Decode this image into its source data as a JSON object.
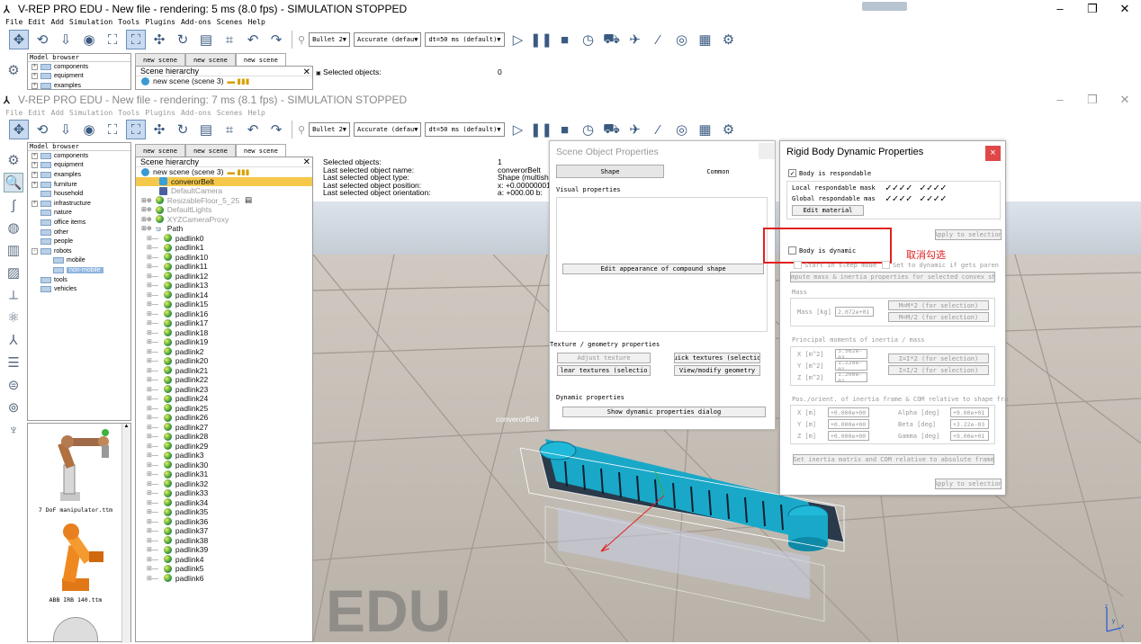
{
  "back_window": {
    "title": "V-REP PRO EDU - New file - rendering: 5 ms (8.0 fps) - SIMULATION STOPPED",
    "menu": [
      "File",
      "Edit",
      "Add",
      "Simulation",
      "Tools",
      "Plugins",
      "Add-ons",
      "Scenes",
      "Help"
    ],
    "model_browser_label": "Model browser",
    "model_items": [
      "components",
      "equipment",
      "examples"
    ],
    "tabs": [
      "new scene",
      "new scene",
      "new scene"
    ],
    "scene_hierarchy_label": "Scene hierarchy",
    "scene_root": "new scene (scene 3)",
    "selected_label": "Selected objects:",
    "selected_value": "0"
  },
  "front_window": {
    "title": "V-REP PRO EDU - New file - rendering: 7 ms (8.1 fps) - SIMULATION STOPPED",
    "menu": [
      "File",
      "Edit",
      "Add",
      "Simulation",
      "Tools",
      "Plugins",
      "Add-ons",
      "Scenes",
      "Help"
    ]
  },
  "toolbar": {
    "engine": "Bullet 2",
    "accuracy": "Accurate (defau",
    "dt": "dt=50 ms (default)"
  },
  "model_browser": {
    "label": "Model browser",
    "items": [
      {
        "label": "components",
        "expand": "+",
        "indent": 0
      },
      {
        "label": "equipment",
        "expand": "+",
        "indent": 0
      },
      {
        "label": "examples",
        "expand": "+",
        "indent": 0
      },
      {
        "label": "furniture",
        "expand": "+",
        "indent": 0
      },
      {
        "label": "household",
        "expand": "",
        "indent": 0
      },
      {
        "label": "infrastructure",
        "expand": "+",
        "indent": 0
      },
      {
        "label": "nature",
        "expand": "",
        "indent": 0
      },
      {
        "label": "office items",
        "expand": "",
        "indent": 0
      },
      {
        "label": "other",
        "expand": "",
        "indent": 0
      },
      {
        "label": "people",
        "expand": "",
        "indent": 0
      },
      {
        "label": "robots",
        "expand": "-",
        "indent": 0
      },
      {
        "label": "mobile",
        "expand": "",
        "indent": 1
      },
      {
        "label": "non-mobile",
        "expand": "",
        "indent": 1,
        "selected": true
      },
      {
        "label": "tools",
        "expand": "",
        "indent": 0
      },
      {
        "label": "vehicles",
        "expand": "",
        "indent": 0
      }
    ],
    "thumbnails": [
      "7 DoF manipulator.ttm",
      "ABB IRB 140.ttm"
    ]
  },
  "scene": {
    "tabs": [
      "new scene",
      "new scene",
      "new scene"
    ],
    "hierarchy_label": "Scene hierarchy",
    "root": "new scene (scene 3)",
    "items": [
      {
        "label": "converorBelt",
        "selected": true,
        "dim": false,
        "indent": 1
      },
      {
        "label": "DefaultCamera",
        "dim": true,
        "indent": 1
      },
      {
        "label": "ResizableFloor_5_25",
        "dim": true,
        "indent": 0
      },
      {
        "label": "DefaultLights",
        "dim": true,
        "indent": 0
      },
      {
        "label": "XYZCameraProxy",
        "dim": true,
        "indent": 0
      },
      {
        "label": "Path",
        "dim": false,
        "indent": 0
      }
    ],
    "padlinks": [
      "padlink0",
      "padlink1",
      "padlink10",
      "padlink11",
      "padlink12",
      "padlink13",
      "padlink14",
      "padlink15",
      "padlink16",
      "padlink17",
      "padlink18",
      "padlink19",
      "padlink2",
      "padlink20",
      "padlink21",
      "padlink22",
      "padlink23",
      "padlink24",
      "padlink25",
      "padlink26",
      "padlink27",
      "padlink28",
      "padlink29",
      "padlink3",
      "padlink30",
      "padlink31",
      "padlink32",
      "padlink33",
      "padlink34",
      "padlink35",
      "padlink36",
      "padlink37",
      "padlink38",
      "padlink39",
      "padlink4",
      "padlink5",
      "padlink6"
    ]
  },
  "info": {
    "labels": [
      "Selected objects:",
      "Last selected object name:",
      "Last selected object type:",
      "Last selected object position:",
      "Last selected object orientation:"
    ],
    "values": [
      "1",
      "converorBelt",
      "Shape (multish",
      "x: +0.00000001",
      "a: +000.00   b:"
    ]
  },
  "viewport": {
    "object_label": "converorBelt",
    "watermark": "EDU"
  },
  "sop": {
    "title": "Scene Object Properties",
    "tab_shape": "Shape",
    "tab_common": "Common",
    "visual_label": "Visual properties",
    "edit_appearance": "Edit appearance of compound shape",
    "texture_label": "Texture / geometry properties",
    "adjust_texture": "Adjust texture",
    "quick_textures": "uick textures (selectio",
    "clear_textures": "lear textures (selectio",
    "view_geometry": "View/modify geometry",
    "dynamic_label": "Dynamic properties",
    "show_dynamic": "Show dynamic properties dialog"
  },
  "rbd": {
    "title": "Rigid Body Dynamic Properties",
    "close": "×",
    "body_respondable": "Body is respondable",
    "local_mask": "Local respondable mask",
    "global_mask": "Global respondable mas",
    "checks": "✓✓✓✓ ✓✓✓✓",
    "edit_material": "Edit material",
    "apply1": "Apply to selection",
    "body_dynamic": "Body is dynamic",
    "annotation": "取消勾选",
    "start_sleep": "Start in sleep mode",
    "set_dynamic": "Set to dynamic if gets paren",
    "compute": "mpute mass & inertia properties for selected convex shap",
    "mass_label": "Mass",
    "mass_field_label": "Mass [kg]",
    "mass_value": "2.072e+01",
    "m_times2": "M=M*2  (for selection)",
    "m_div2": "M=M/2  (for selection)",
    "inertia_label": "Principal moments of inertia / mass",
    "ix_label": "X [m^2]",
    "ix": "3.562e-03",
    "iy_label": "Y [m^2]",
    "iy": "1.228e-01",
    "iz_label": "Z [m^2]",
    "iz": "1.206e-01",
    "i_times2": "I=I*2  (for selection)",
    "i_div2": "I=I/2  (for selection)",
    "pos_label": "Pos./orient. of inertia frame & COM relative to shape fra",
    "px_label": "X [m]",
    "px": "+0.000e+00",
    "py_label": "Y [m]",
    "py": "+0.000e+00",
    "pz_label": "Z [m]",
    "pz": "+0.000e+00",
    "alpha_label": "Alpha [deg]",
    "alpha": "+9.00e+01",
    "beta_label": "Beta [deg]",
    "beta": "+3.22e-03",
    "gamma_label": "Gamma [deg]",
    "gamma": "+9.00e+01",
    "set_inertia": "Set inertia matrix and COM relative to absolute frame",
    "apply2": "Apply to selection"
  },
  "colors": {
    "accent": "#4a90d9",
    "annotation": "#e02020",
    "selection": "#f5c84a"
  }
}
